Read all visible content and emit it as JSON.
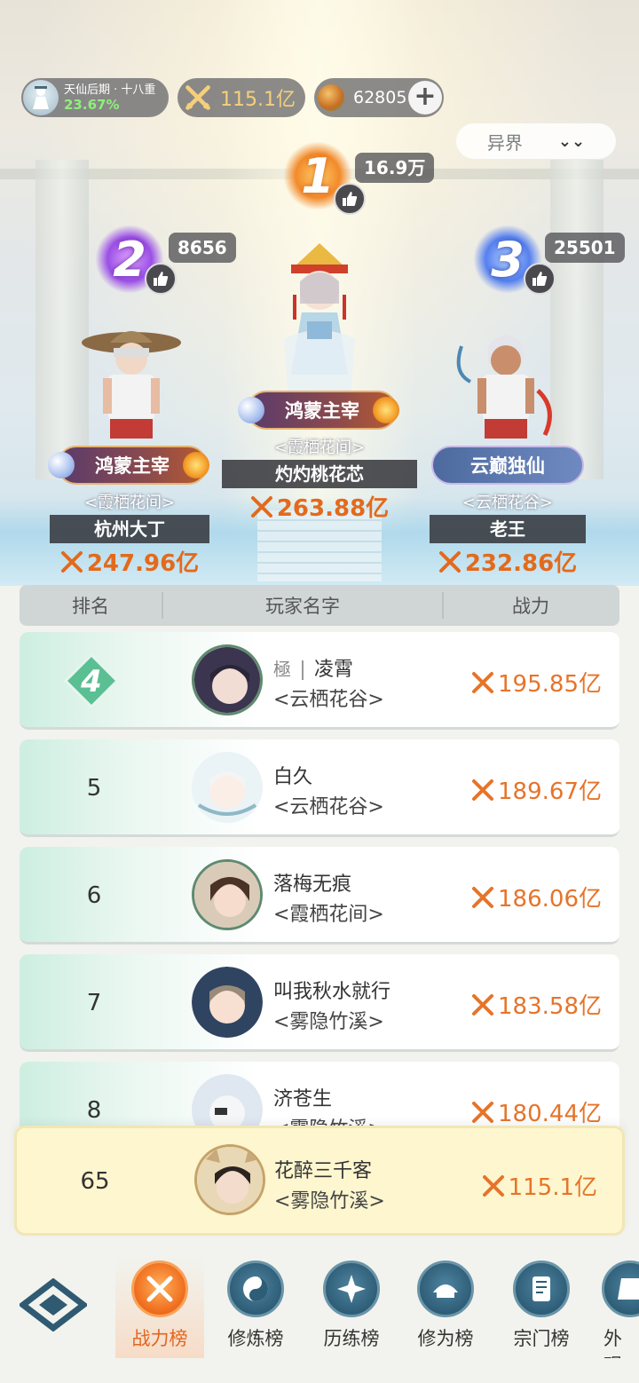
{
  "hud": {
    "realm_name": "天仙后期 · 十八重",
    "realm_progress": "23.67%",
    "power": "115.1亿",
    "currency": "62805",
    "currency_icon": "spirit-stone-icon"
  },
  "realm_select": {
    "selected": "异界"
  },
  "podium": [
    {
      "rank": "1",
      "likes": "16.9万",
      "title": "鸿蒙主宰",
      "guild": "<霞栖花间>",
      "name": "灼灼桃花芯",
      "power": "263.88亿"
    },
    {
      "rank": "2",
      "likes": "8656",
      "title": "鸿蒙主宰",
      "guild": "<霞栖花间>",
      "name": "杭州大丁",
      "power": "247.96亿"
    },
    {
      "rank": "3",
      "likes": "25501",
      "title": "云巅独仙",
      "guild": "<云栖花谷>",
      "name": "老王",
      "power": "232.86亿"
    }
  ],
  "table": {
    "headers": [
      "排名",
      "玩家名字",
      "战力"
    ],
    "rows": [
      {
        "rank": "4",
        "title_tag": "極",
        "name": "凌霄",
        "guild": "<云栖花谷>",
        "power": "195.85亿"
      },
      {
        "rank": "5",
        "name": "白久",
        "guild": "<云栖花谷>",
        "power": "189.67亿"
      },
      {
        "rank": "6",
        "name": "落梅无痕",
        "guild": "<霞栖花间>",
        "power": "186.06亿"
      },
      {
        "rank": "7",
        "name": "叫我秋水就行",
        "guild": "<雾隐竹溪>",
        "power": "183.58亿"
      },
      {
        "rank": "8",
        "name": "济苍生",
        "guild": "<雾隐竹溪>",
        "power": "180.44亿"
      }
    ],
    "self": {
      "rank": "65",
      "name": "花醉三千客",
      "guild": "<雾隐竹溪>",
      "power": "115.1亿"
    }
  },
  "nav": {
    "items": [
      {
        "label": "战力榜",
        "icon": "crossed-swords-icon",
        "active": true
      },
      {
        "label": "修炼榜",
        "icon": "yin-yang-icon"
      },
      {
        "label": "历练榜",
        "icon": "compass-star-icon"
      },
      {
        "label": "修为榜",
        "icon": "hat-icon"
      },
      {
        "label": "宗门榜",
        "icon": "scroll-icon"
      },
      {
        "label": "外观",
        "icon": "wardrobe-icon"
      }
    ]
  },
  "colors": {
    "accent": "#e6742a",
    "active_tab": "#ee6a1a",
    "header_bg": "#cfd6d5"
  }
}
